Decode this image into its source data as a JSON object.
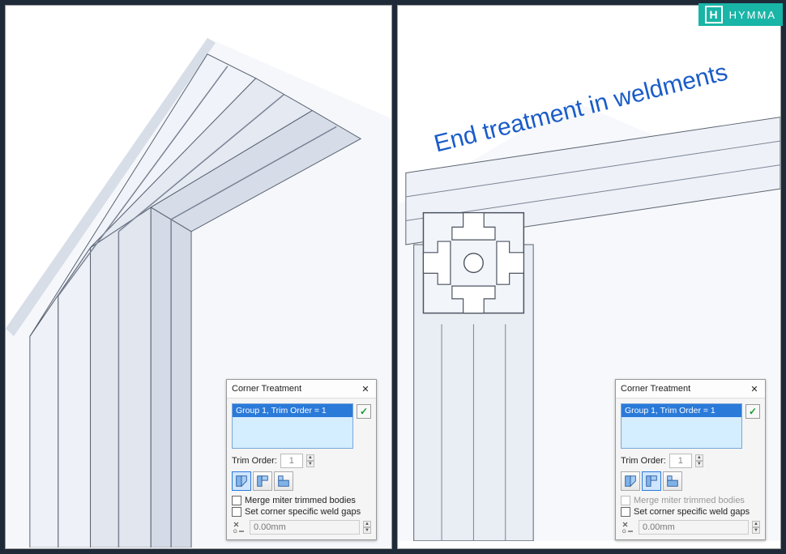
{
  "brand": {
    "icon_letter": "H",
    "name": "HYMMA"
  },
  "annotation_text": "End treatment in weldments",
  "dialog_left": {
    "title": "Corner Treatment",
    "close_glyph": "✕",
    "list_item": "Group 1, Trim Order = 1",
    "ok_glyph": "✓",
    "trim_label": "Trim Order:",
    "trim_value": "1",
    "corner_type_selected_index": 0,
    "merge_label": "Merge miter trimmed bodies",
    "merge_checked": false,
    "merge_disabled": false,
    "setgap_label": "Set corner specific weld gaps",
    "setgap_checked": false,
    "gap_value": "0.00mm"
  },
  "dialog_right": {
    "title": "Corner Treatment",
    "close_glyph": "✕",
    "list_item": "Group 1, Trim Order = 1",
    "ok_glyph": "✓",
    "trim_label": "Trim Order:",
    "trim_value": "1",
    "corner_type_selected_index": 1,
    "merge_label": "Merge miter trimmed bodies",
    "merge_checked": false,
    "merge_disabled": true,
    "setgap_label": "Set corner specific weld gaps",
    "setgap_checked": false,
    "gap_value": "0.00mm"
  }
}
